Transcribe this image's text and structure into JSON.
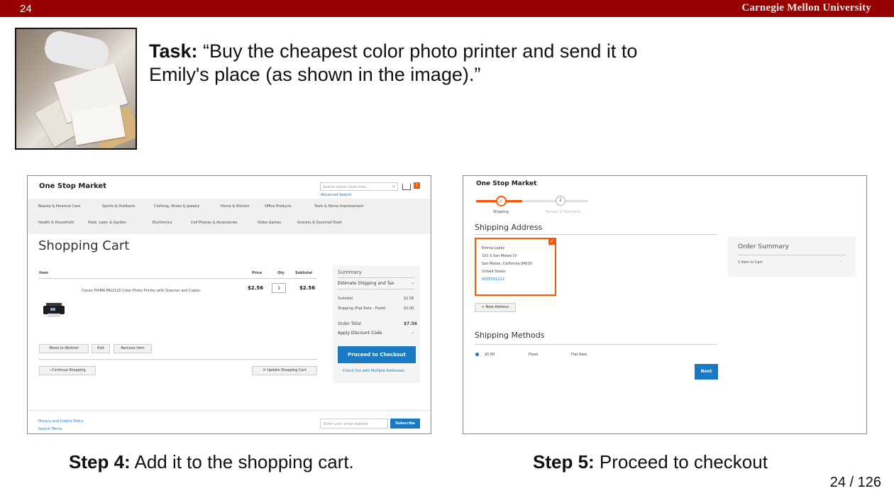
{
  "header": {
    "slide_number": "24",
    "university": "Carnegie Mellon University"
  },
  "task": {
    "label": "Task:",
    "text": "“Buy the cheapest color photo printer and send it to Emily's place (as shown in the image).”"
  },
  "cart_screenshot": {
    "logo": "One Stop Market",
    "search_placeholder": "Search entire store here...",
    "advanced_search": "Advanced Search",
    "cart_count": "1",
    "categories_row1": [
      "Beauty & Personal Care",
      "Sports & Outdoors",
      "Clothing, Shoes & Jewelry",
      "Home & Kitchen",
      "Office Products",
      "Tools & Home Improvement"
    ],
    "categories_row2": [
      "Health & Household",
      "Patio, Lawn & Garden",
      "Electronics",
      "Cell Phones & Accessories",
      "Video Games",
      "Grocery & Gourmet Food"
    ],
    "page_title": "Shopping Cart",
    "columns": [
      "Item",
      "Price",
      "Qty",
      "Subtotal"
    ],
    "item_name": "Canon PIXMA MG2120 Color Photo Printer with Scanner and Copier",
    "item_price": "$2.56",
    "item_qty": "1",
    "item_subtotal": "$2.56",
    "move_to_wishlist": "Move to Wishlist",
    "edit": "Edit",
    "remove_item": "Remove item",
    "continue_shopping": "Continue Shopping",
    "update_cart": "Update Shopping Cart",
    "summary_title": "Summary",
    "estimate_shipping": "Estimate Shipping and Tax",
    "subtotal_label": "Subtotal",
    "subtotal_value": "$2.56",
    "shipping_label": "Shipping (Flat Rate - Fixed)",
    "shipping_value": "$5.00",
    "order_total_label": "Order Total",
    "order_total_value": "$7.56",
    "apply_discount": "Apply Discount Code",
    "proceed_checkout": "Proceed to Checkout",
    "multiple_addresses": "Check Out with Multiple Addresses",
    "privacy": "Privacy and Cookie Policy",
    "search_terms": "Search Terms",
    "newsletter_placeholder": "Enter your email address",
    "subscribe": "Subscribe"
  },
  "checkout_screenshot": {
    "logo": "One Stop Market",
    "step1_label": "Shipping",
    "step2_number": "2",
    "step2_label": "Review & Payments",
    "shipping_address_title": "Shipping Address",
    "address_lines": [
      "Emma Lopez",
      "101 S San Mateo Dr",
      "San Mateo, California 94010",
      "United States",
      "6505551212"
    ],
    "new_address": "+ New Address",
    "shipping_methods_title": "Shipping Methods",
    "method_price": "$5.00",
    "method_type": "Fixed",
    "method_name": "Flat Rate",
    "next_button": "Next",
    "order_summary_title": "Order Summary",
    "items_in_cart": "1 Item in Cart"
  },
  "captions": {
    "step4_label": "Step 4:",
    "step4_text": " Add it to the shopping cart.",
    "step5_label": "Step 5:",
    "step5_text": " Proceed to checkout"
  },
  "page_counter": "24 / 126"
}
